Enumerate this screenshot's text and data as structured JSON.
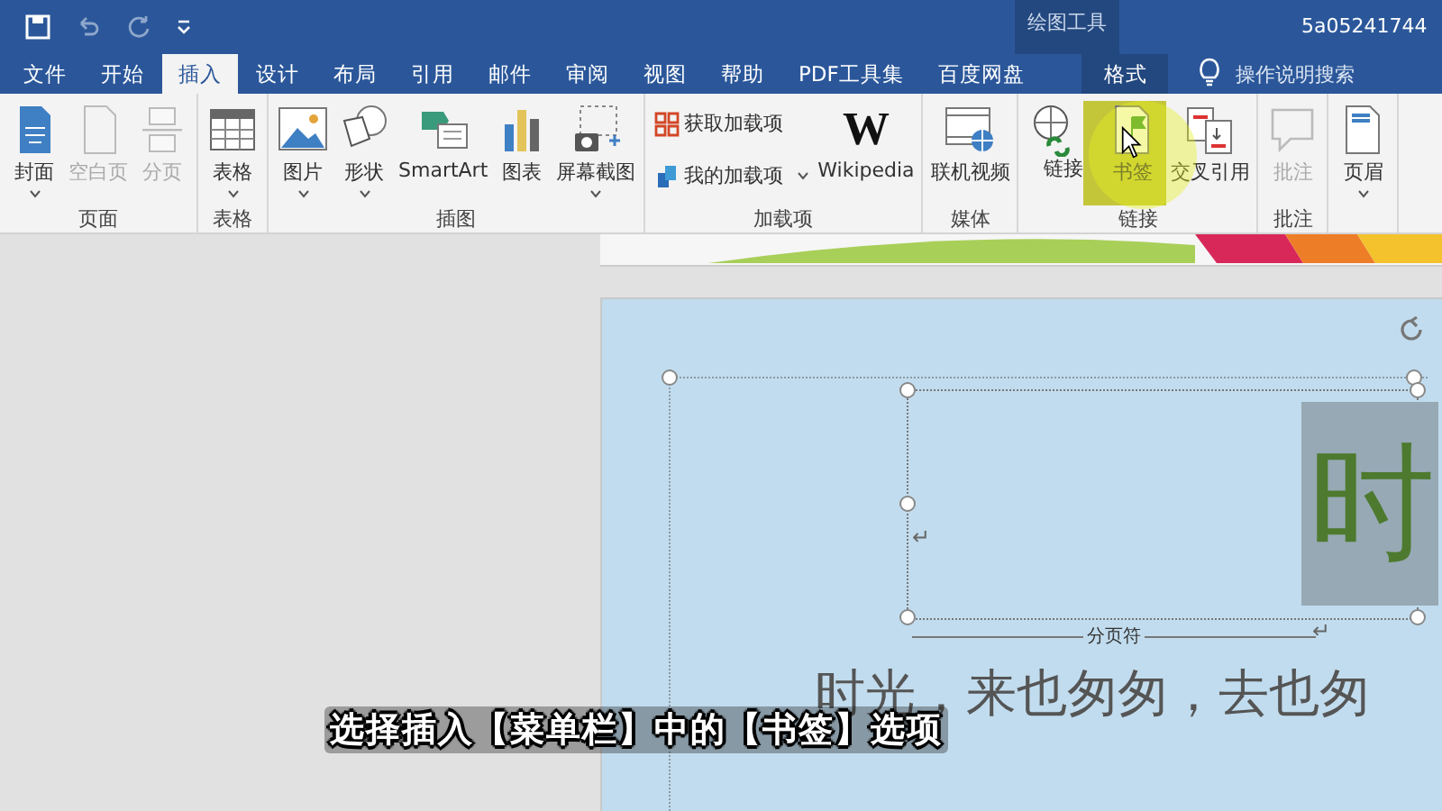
{
  "window": {
    "title": "5a05241744",
    "contextual_tab_group": "绘图工具"
  },
  "tabs": [
    {
      "label": "文件",
      "selected": false,
      "contextual": false
    },
    {
      "label": "开始",
      "selected": false,
      "contextual": false
    },
    {
      "label": "插入",
      "selected": true,
      "contextual": false
    },
    {
      "label": "设计",
      "selected": false,
      "contextual": false
    },
    {
      "label": "布局",
      "selected": false,
      "contextual": false
    },
    {
      "label": "引用",
      "selected": false,
      "contextual": false
    },
    {
      "label": "邮件",
      "selected": false,
      "contextual": false
    },
    {
      "label": "审阅",
      "selected": false,
      "contextual": false
    },
    {
      "label": "视图",
      "selected": false,
      "contextual": false
    },
    {
      "label": "帮助",
      "selected": false,
      "contextual": false
    },
    {
      "label": "PDF工具集",
      "selected": false,
      "contextual": false
    },
    {
      "label": "百度网盘",
      "selected": false,
      "contextual": false
    },
    {
      "label": "格式",
      "selected": false,
      "contextual": true
    }
  ],
  "tell_me": {
    "placeholder": "操作说明搜索"
  },
  "ribbon_groups": [
    {
      "label": "页面",
      "items": [
        {
          "label": "封面",
          "kind": "large",
          "dropdown": true,
          "disabled": false,
          "highlighted": false
        },
        {
          "label": "空白页",
          "kind": "large",
          "dropdown": false,
          "disabled": true,
          "highlighted": false
        },
        {
          "label": "分页",
          "kind": "large",
          "dropdown": false,
          "disabled": true,
          "highlighted": false
        }
      ]
    },
    {
      "label": "表格",
      "items": [
        {
          "label": "表格",
          "kind": "large",
          "dropdown": true,
          "disabled": false,
          "highlighted": false
        }
      ]
    },
    {
      "label": "插图",
      "items": [
        {
          "label": "图片",
          "kind": "large",
          "dropdown": true,
          "disabled": false,
          "highlighted": false
        },
        {
          "label": "形状",
          "kind": "large",
          "dropdown": true,
          "disabled": false,
          "highlighted": false
        },
        {
          "label": "SmartArt",
          "kind": "large",
          "dropdown": false,
          "disabled": false,
          "highlighted": false
        },
        {
          "label": "图表",
          "kind": "large",
          "dropdown": false,
          "disabled": false,
          "highlighted": false
        },
        {
          "label": "屏幕截图",
          "kind": "large",
          "dropdown": true,
          "disabled": false,
          "highlighted": false
        }
      ]
    },
    {
      "label": "加载项",
      "items": [
        {
          "label": "获取加载项",
          "kind": "small",
          "dropdown": false,
          "disabled": false,
          "highlighted": false
        },
        {
          "label": "我的加载项",
          "kind": "small",
          "dropdown": true,
          "disabled": false,
          "highlighted": false
        },
        {
          "label": "Wikipedia",
          "kind": "logo",
          "logo_text": "W",
          "dropdown": false,
          "disabled": false,
          "highlighted": false
        }
      ]
    },
    {
      "label": "媒体",
      "items": [
        {
          "label": "联机视频",
          "kind": "large",
          "dropdown": false,
          "disabled": false,
          "highlighted": false
        }
      ]
    },
    {
      "label": "链接",
      "items": [
        {
          "label": "链接",
          "kind": "tall",
          "dropdown": false,
          "disabled": false,
          "highlighted": false
        },
        {
          "label": "书签",
          "kind": "large",
          "dropdown": false,
          "disabled": false,
          "highlighted": true
        },
        {
          "label": "交叉引用",
          "kind": "large",
          "dropdown": false,
          "disabled": false,
          "highlighted": false
        }
      ]
    },
    {
      "label": "批注",
      "items": [
        {
          "label": "批注",
          "kind": "large",
          "dropdown": false,
          "disabled": true,
          "highlighted": false
        }
      ]
    },
    {
      "items": [
        {
          "label": "页眉",
          "kind": "large",
          "dropdown": true,
          "disabled": false,
          "highlighted": false
        }
      ]
    }
  ],
  "document": {
    "paragraph_marks": [
      "↵",
      "↵"
    ],
    "page_break_label": "分页符",
    "title_char": "时",
    "body_line": "时光，来也匆匆，去也匆"
  },
  "subtitle": "选择插入【菜单栏】中的【书签】选项"
}
